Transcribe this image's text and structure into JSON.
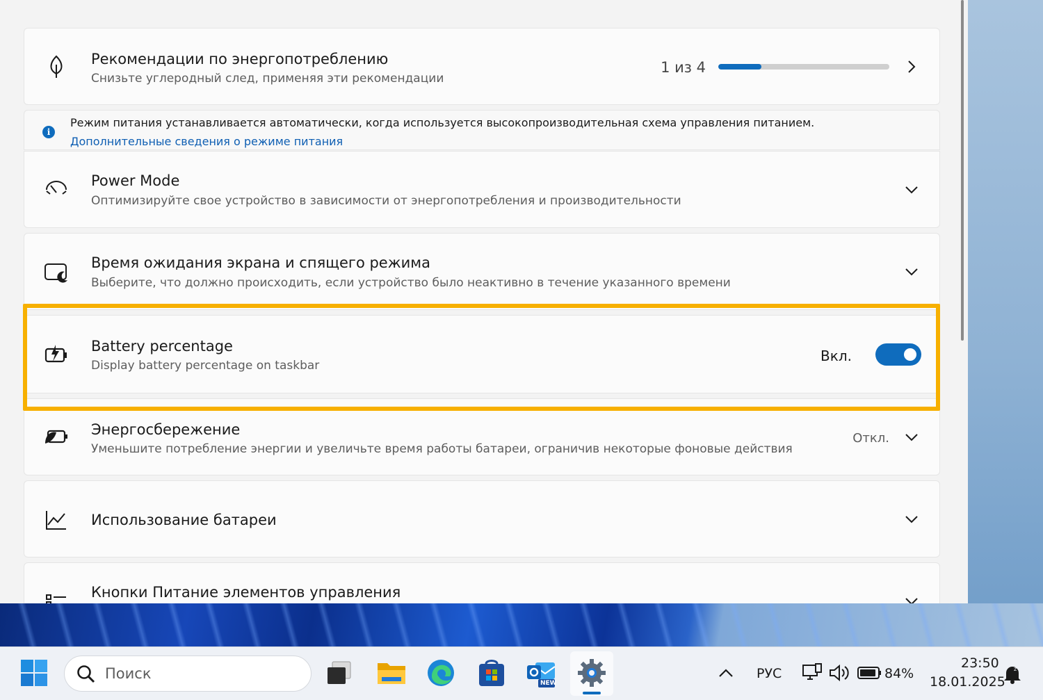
{
  "settings": {
    "recommendations": {
      "title": "Рекомендации по энергопотреблению",
      "subtitle": "Снизьте углеродный след, применяя эти рекомендации",
      "progress_label": "1 из 4",
      "progress_fraction": 0.25
    },
    "info": {
      "text": "Режим питания устанавливается автоматически, когда используется высокопроизводительная схема управления питанием.",
      "link": "Дополнительные сведения о режиме питания"
    },
    "power_mode": {
      "title": "Power Mode",
      "subtitle": "Оптимизируйте свое устройство в зависимости от энергопотребления и производительности"
    },
    "screen_timeout": {
      "title": "Время ожидания экрана и спящего режима",
      "subtitle": "Выберите, что должно происходить, если устройство было неактивно в течение указанного времени"
    },
    "battery_percentage": {
      "title": "Battery percentage",
      "subtitle": "Display battery percentage on taskbar",
      "state_label": "Вкл.",
      "enabled": true
    },
    "energy_saver": {
      "title": "Энергосбережение",
      "subtitle": "Уменьшите потребление энергии и увеличьте время работы батареи, ограничив некоторые фоновые действия",
      "state_label": "Откл."
    },
    "battery_usage": {
      "title": "Использование батареи"
    },
    "power_buttons": {
      "title": "Кнопки Питание элементов управления"
    }
  },
  "taskbar": {
    "search_placeholder": "Поиск",
    "language": "РУС",
    "battery_percent": "84%",
    "time": "23:50",
    "date": "18.01.2025",
    "apps": [
      "start-icon",
      "task-view-icon",
      "file-explorer-icon",
      "edge-icon",
      "store-icon",
      "outlook-icon",
      "settings-icon"
    ],
    "outlook_badge": "NEW"
  },
  "colors": {
    "accent": "#0f6cbd",
    "highlight": "#f7b000"
  }
}
